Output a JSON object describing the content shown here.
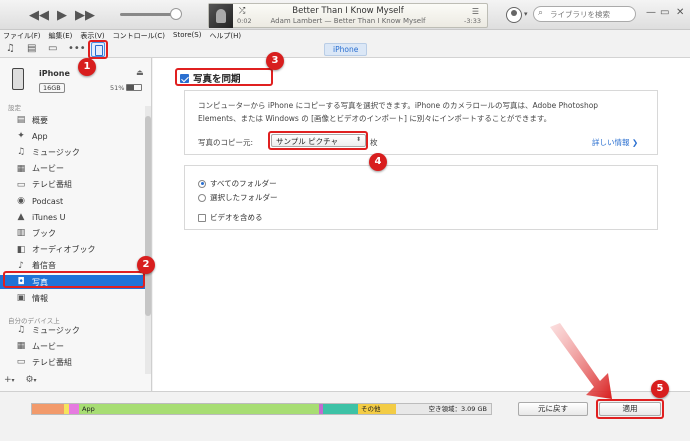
{
  "titlebar": {
    "track_title": "Better Than I Know Myself",
    "track_sub": "Adam Lambert — Better Than I Know Myself",
    "time_elapsed": "0:02",
    "time_remaining": "-3:33",
    "search_placeholder": "ライブラリを検索",
    "win_min": "—",
    "win_max": "▭",
    "win_close": "✕"
  },
  "menu": [
    "ファイル(F)",
    "編集(E)",
    "表示(V)",
    "コントロール(C)",
    "Store(S)",
    "ヘルプ(H)"
  ],
  "device_tab": "iPhone",
  "device": {
    "name": "iPhone",
    "capacity": "16GB",
    "battery": "51%",
    "battery_level": 0.51
  },
  "sidebar": {
    "section_settings": "設定",
    "section_mydevice": "自分のデバイス上",
    "settings_items": [
      {
        "label": "概要",
        "icon": "summary-icon"
      },
      {
        "label": "App",
        "icon": "app-icon"
      },
      {
        "label": "ミュージック",
        "icon": "music-icon"
      },
      {
        "label": "ムービー",
        "icon": "movie-icon"
      },
      {
        "label": "テレビ番組",
        "icon": "tv-icon"
      },
      {
        "label": "Podcast",
        "icon": "podcast-icon"
      },
      {
        "label": "iTunes U",
        "icon": "itunes-u-icon"
      },
      {
        "label": "ブック",
        "icon": "book-icon"
      },
      {
        "label": "オーディオブック",
        "icon": "audiobook-icon"
      },
      {
        "label": "着信音",
        "icon": "bell-icon"
      },
      {
        "label": "写真",
        "icon": "camera-icon"
      },
      {
        "label": "情報",
        "icon": "info-icon"
      }
    ],
    "device_items": [
      {
        "label": "ミュージック",
        "icon": "music-icon"
      },
      {
        "label": "ムービー",
        "icon": "movie-icon"
      },
      {
        "label": "テレビ番組",
        "icon": "tv-icon"
      }
    ],
    "add_label": "+",
    "gear_label": "⚙"
  },
  "main": {
    "sync_label": "写真を同期",
    "description": "コンピューターから iPhone にコピーする写真を選択できます。iPhone のカメラロールの写真は、Adobe Photoshop Elements、または Windows の [画像とビデオのインポート] に別々にインポートすることができます。",
    "copy_from_label": "写真のコピー元:",
    "copy_from_value": "サンプル ピクチャ",
    "count_suffix": "枚",
    "detail_link": "詳しい情報 ❯",
    "radio_all": "すべてのフォルダー",
    "radio_selected": "選択したフォルダー",
    "include_video": "ビデオを含める"
  },
  "capacity": {
    "app_label": "App",
    "other_label": "その他",
    "free_label": "空き領域：3.09 GB"
  },
  "buttons": {
    "revert": "元に戻す",
    "apply": "適用"
  },
  "callouts": [
    "1",
    "2",
    "3",
    "4",
    "5"
  ],
  "colors": {
    "accent": "#1f73d7",
    "callout": "#d81e1e",
    "app_seg": "#a7dd73",
    "other_seg": "#f3cc45",
    "teal_seg": "#3dc2a6"
  }
}
